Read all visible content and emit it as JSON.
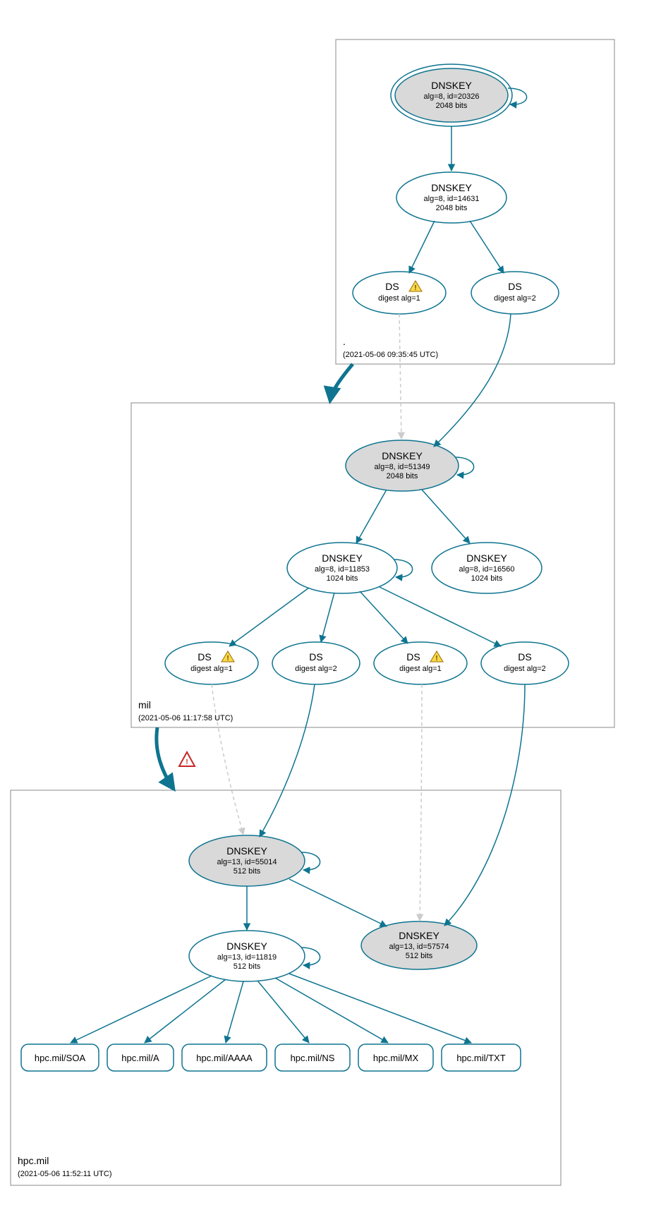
{
  "zones": {
    "root": {
      "label": ".",
      "timestamp": "(2021-05-06 09:35:45 UTC)"
    },
    "mil": {
      "label": "mil",
      "timestamp": "(2021-05-06 11:17:58 UTC)"
    },
    "hpc": {
      "label": "hpc.mil",
      "timestamp": "(2021-05-06 11:52:11 UTC)"
    }
  },
  "nodes": {
    "root_ksk": {
      "title": "DNSKEY",
      "l1": "alg=8, id=20326",
      "l2": "2048 bits"
    },
    "root_zsk": {
      "title": "DNSKEY",
      "l1": "alg=8, id=14631",
      "l2": "2048 bits"
    },
    "root_ds1": {
      "title": "DS",
      "l1": "digest alg=1"
    },
    "root_ds2": {
      "title": "DS",
      "l1": "digest alg=2"
    },
    "mil_ksk": {
      "title": "DNSKEY",
      "l1": "alg=8, id=51349",
      "l2": "2048 bits"
    },
    "mil_zsk1": {
      "title": "DNSKEY",
      "l1": "alg=8, id=11853",
      "l2": "1024 bits"
    },
    "mil_zsk2": {
      "title": "DNSKEY",
      "l1": "alg=8, id=16560",
      "l2": "1024 bits"
    },
    "mil_ds1": {
      "title": "DS",
      "l1": "digest alg=1"
    },
    "mil_ds2": {
      "title": "DS",
      "l1": "digest alg=2"
    },
    "mil_ds3": {
      "title": "DS",
      "l1": "digest alg=1"
    },
    "mil_ds4": {
      "title": "DS",
      "l1": "digest alg=2"
    },
    "hpc_ksk1": {
      "title": "DNSKEY",
      "l1": "alg=13, id=55014",
      "l2": "512 bits"
    },
    "hpc_ksk2": {
      "title": "DNSKEY",
      "l1": "alg=13, id=57574",
      "l2": "512 bits"
    },
    "hpc_zsk": {
      "title": "DNSKEY",
      "l1": "alg=13, id=11819",
      "l2": "512 bits"
    }
  },
  "rr": {
    "soa": "hpc.mil/SOA",
    "a": "hpc.mil/A",
    "aaaa": "hpc.mil/AAAA",
    "ns": "hpc.mil/NS",
    "mx": "hpc.mil/MX",
    "txt": "hpc.mil/TXT"
  },
  "colors": {
    "stroke": "#0e7490",
    "ksk_fill": "#d9d9d9"
  }
}
